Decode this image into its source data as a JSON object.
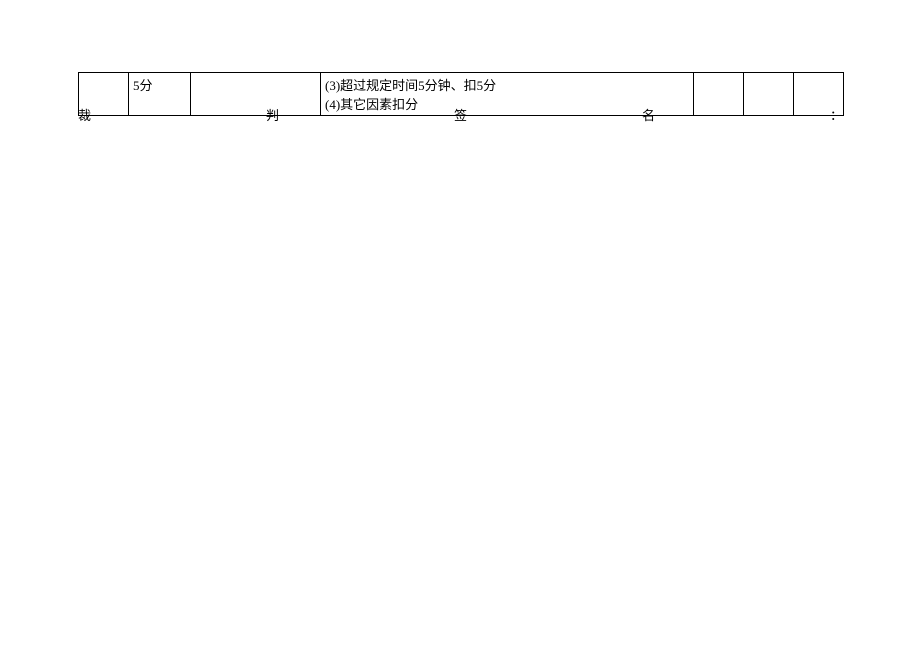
{
  "table": {
    "row": {
      "col2": "5分",
      "col4_line1": "(3)超过规定时间5分钟、扣5分",
      "col4_line2": "(4)其它因素扣分"
    }
  },
  "signature": {
    "c1": "裁",
    "c2": "判",
    "c3": "签",
    "c4": "名",
    "c5": "："
  }
}
